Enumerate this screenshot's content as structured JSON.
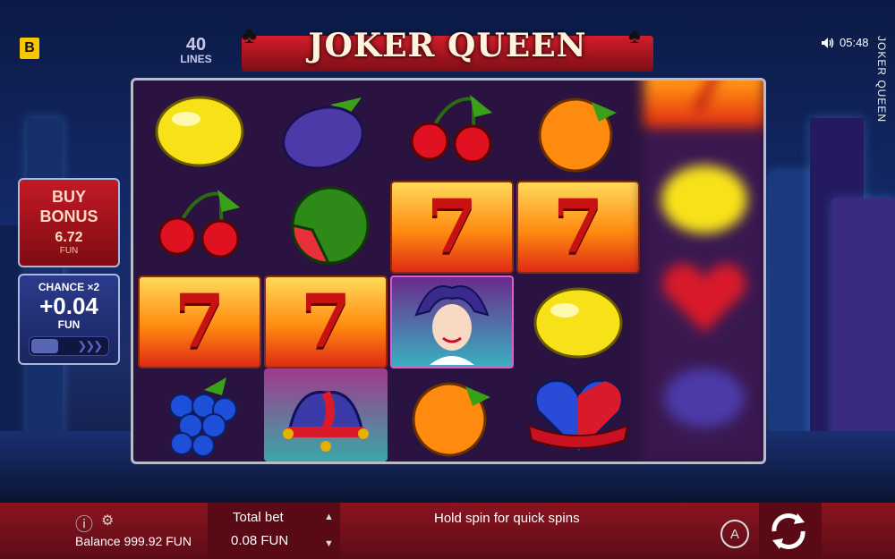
{
  "header": {
    "brand_badge": "B",
    "lines_number": "40",
    "lines_label": "LINES",
    "logo_title": "JOKER QUEEN",
    "time": "05:48",
    "game_title_vertical": "JOKER QUEEN"
  },
  "buy_bonus": {
    "label_line1": "BUY",
    "label_line2": "BONUS",
    "value": "6.72",
    "unit": "FUN"
  },
  "chance": {
    "label": "CHANCE ×2",
    "value": "+0.04",
    "unit": "FUN"
  },
  "reels": [
    [
      "lemon",
      "cherries",
      "seven",
      "grapes"
    ],
    [
      "plum",
      "watermelon",
      "seven",
      "jester-hat"
    ],
    [
      "cherries",
      "seven",
      "joker-queen",
      "orange"
    ],
    [
      "orange",
      "seven",
      "lemon",
      "heart-ribbon"
    ],
    [
      "seven",
      "lemon",
      "heart-ribbon",
      "plum"
    ]
  ],
  "bottom_bar": {
    "balance_label": "Balance",
    "balance_value": "999.92 FUN",
    "total_bet_label": "Total bet",
    "total_bet_value": "0.08 FUN",
    "hint": "Hold spin for quick spins",
    "auto_label": "A"
  },
  "colors": {
    "accent_red": "#c21a24",
    "bar_red": "#8a1420",
    "chance_blue": "#2b3a8c",
    "brand_yellow": "#f7c600"
  }
}
